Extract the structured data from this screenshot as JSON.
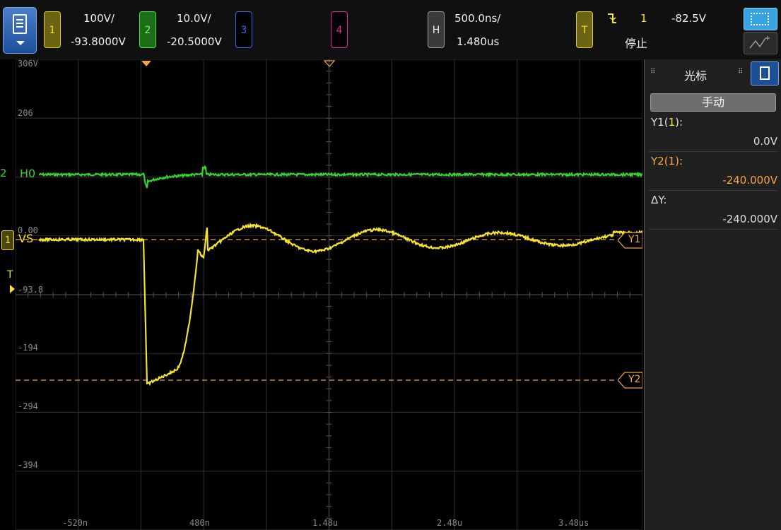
{
  "topbar": {
    "channel1": {
      "number": "1",
      "scale": "100V/",
      "offset": "-93.8000V"
    },
    "channel2": {
      "number": "2",
      "scale": "10.0V/",
      "offset": "-20.5000V"
    },
    "channel3": {
      "number": "3"
    },
    "channel4": {
      "number": "4"
    },
    "horizontal": {
      "label": "H",
      "timebase": "500.0ns/",
      "delay": "1.480us"
    },
    "trigger": {
      "label": "T",
      "source": "1",
      "level": "-82.5V",
      "status": "停止"
    }
  },
  "display": {
    "y_labels": [
      "306V",
      "206",
      "-93.8",
      "-194",
      "-294",
      "-394"
    ],
    "partial_label": "0.00",
    "x_labels": [
      "-520n",
      "480n",
      "1.48u",
      "2.48u",
      "3.48us"
    ],
    "ch2_marker": "2",
    "ch2_name": "H0",
    "ch1_marker": "1",
    "ch1_name": "VS",
    "trigger_marker": "T",
    "cursor_y1_label": "Y1",
    "cursor_y2_label": "Y2"
  },
  "panel": {
    "title": "光标",
    "mode": "手动",
    "y1_label_prefix": "Y1(",
    "y1_label_ch": "1",
    "y1_label_suffix": "):",
    "y1_value": "0.0V",
    "y2_label": "Y2(1):",
    "y2_value": "-240.000V",
    "dy_label": "ΔY:",
    "dy_value": "-240.000V"
  },
  "colors": {
    "ch1": "#f4e130",
    "ch2": "#35d22b",
    "ch3": "#3b6cf0",
    "ch4": "#e8289a",
    "cursor": "#f4a640",
    "accent": "#1d4f99"
  }
}
